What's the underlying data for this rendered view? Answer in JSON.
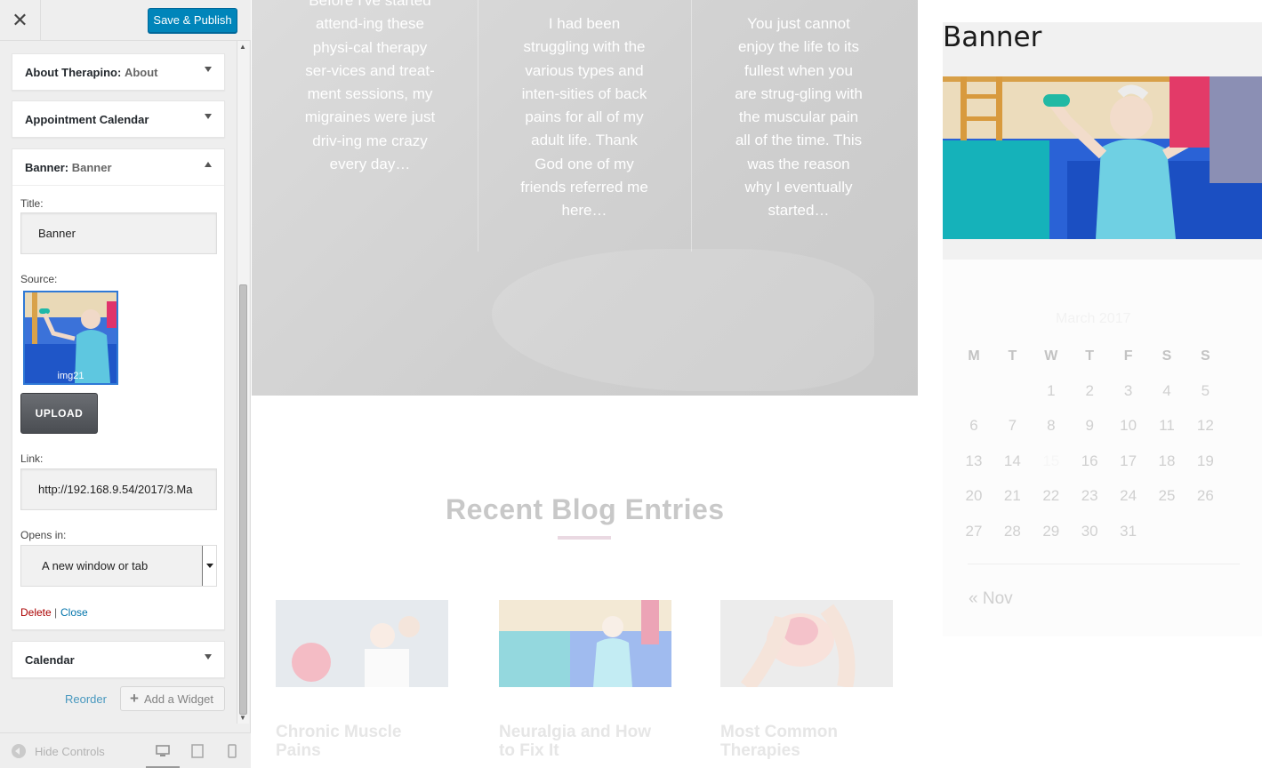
{
  "topbar": {
    "close_glyph": "✕",
    "publish_label": "Save & Publish"
  },
  "widgets": {
    "about": {
      "title": "About Therapino:",
      "subtitle": "About"
    },
    "appointment": {
      "title": "Appointment Calendar"
    },
    "banner": {
      "title": "Banner:",
      "subtitle": "Banner",
      "title_label": "Title:",
      "title_value": "Banner",
      "source_label": "Source:",
      "image_name": "img21",
      "upload_label": "UPLOAD",
      "link_label": "Link:",
      "link_value": "http://192.168.9.54/2017/3.Ma",
      "opens_label": "Opens in:",
      "opens_value": "A new window or tab",
      "delete_label": "Delete",
      "separator": "|",
      "close_label": "Close"
    },
    "calendar": {
      "title": "Calendar"
    }
  },
  "panel_actions": {
    "reorder_label": "Reorder",
    "add_widget_label": "Add a Widget"
  },
  "footer": {
    "hide_controls_label": "Hide Controls",
    "devices": [
      "desktop-icon",
      "tablet-icon",
      "mobile-icon"
    ]
  },
  "preview": {
    "quotes": [
      "Before I've started attend-ing these physi-cal therapy ser-vices and treat-ment sessions, my migraines were just driv-ing me crazy every day…",
      "I had been struggling with the various types and inten-sities of back pains for all of my adult life. Thank God one of my friends referred me here…",
      "You just cannot enjoy the life to its fullest when you are strug-gling with the muscular pain all of the time. This was the reason why I eventually started…"
    ],
    "blog_heading": "Recent Blog Entries",
    "blog_titles": [
      "Chronic Muscle Pains",
      "Neuralgia and How to Fix It",
      "Most Common Therapies"
    ],
    "banner_heading": "Banner",
    "calendar": {
      "month": "March 2017",
      "weekdays": [
        "M",
        "T",
        "W",
        "T",
        "F",
        "S",
        "S"
      ],
      "weeks": [
        [
          "",
          "",
          "1",
          "2",
          "3",
          "4",
          "5"
        ],
        [
          "6",
          "7",
          "8",
          "9",
          "10",
          "11",
          "12"
        ],
        [
          "13",
          "14",
          "15",
          "16",
          "17",
          "18",
          "19"
        ],
        [
          "20",
          "21",
          "22",
          "23",
          "24",
          "25",
          "26"
        ],
        [
          "27",
          "28",
          "29",
          "30",
          "31",
          "",
          ""
        ]
      ],
      "prev_link": "« Nov"
    }
  },
  "colors": {
    "publish": "#0085ba",
    "link": "#0073aa",
    "delete": "#a00000",
    "sidebar_bg": "#eeeeee"
  }
}
